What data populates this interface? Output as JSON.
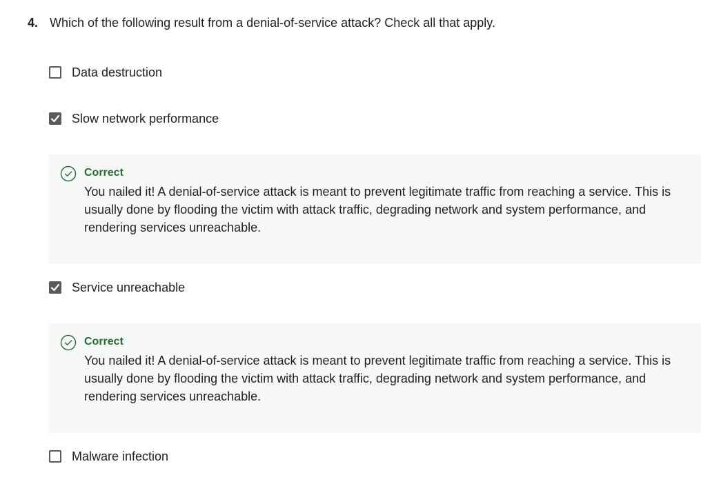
{
  "question": {
    "number": "4.",
    "text": "Which of the following result from a denial-of-service attack? Check all that apply."
  },
  "options": [
    {
      "label": "Data destruction",
      "checked": false
    },
    {
      "label": "Slow network performance",
      "checked": true
    },
    {
      "label": "Service unreachable",
      "checked": true
    },
    {
      "label": "Malware infection",
      "checked": false
    }
  ],
  "feedback": [
    {
      "title": "Correct",
      "body": "You nailed it! A denial-of-service attack is meant to prevent legitimate traffic from reaching a service. This is usually done by flooding the victim with attack traffic, degrading network and system performance, and rendering services unreachable."
    },
    {
      "title": "Correct",
      "body": "You nailed it! A denial-of-service attack is meant to prevent legitimate traffic from reaching a service. This is usually done by flooding the victim with attack traffic, degrading network and system performance, and rendering services unreachable."
    }
  ],
  "colors": {
    "correct": "#2b6b34",
    "checkbox_checked": "#5a5a5a",
    "feedback_bg": "#f6f8f7"
  }
}
